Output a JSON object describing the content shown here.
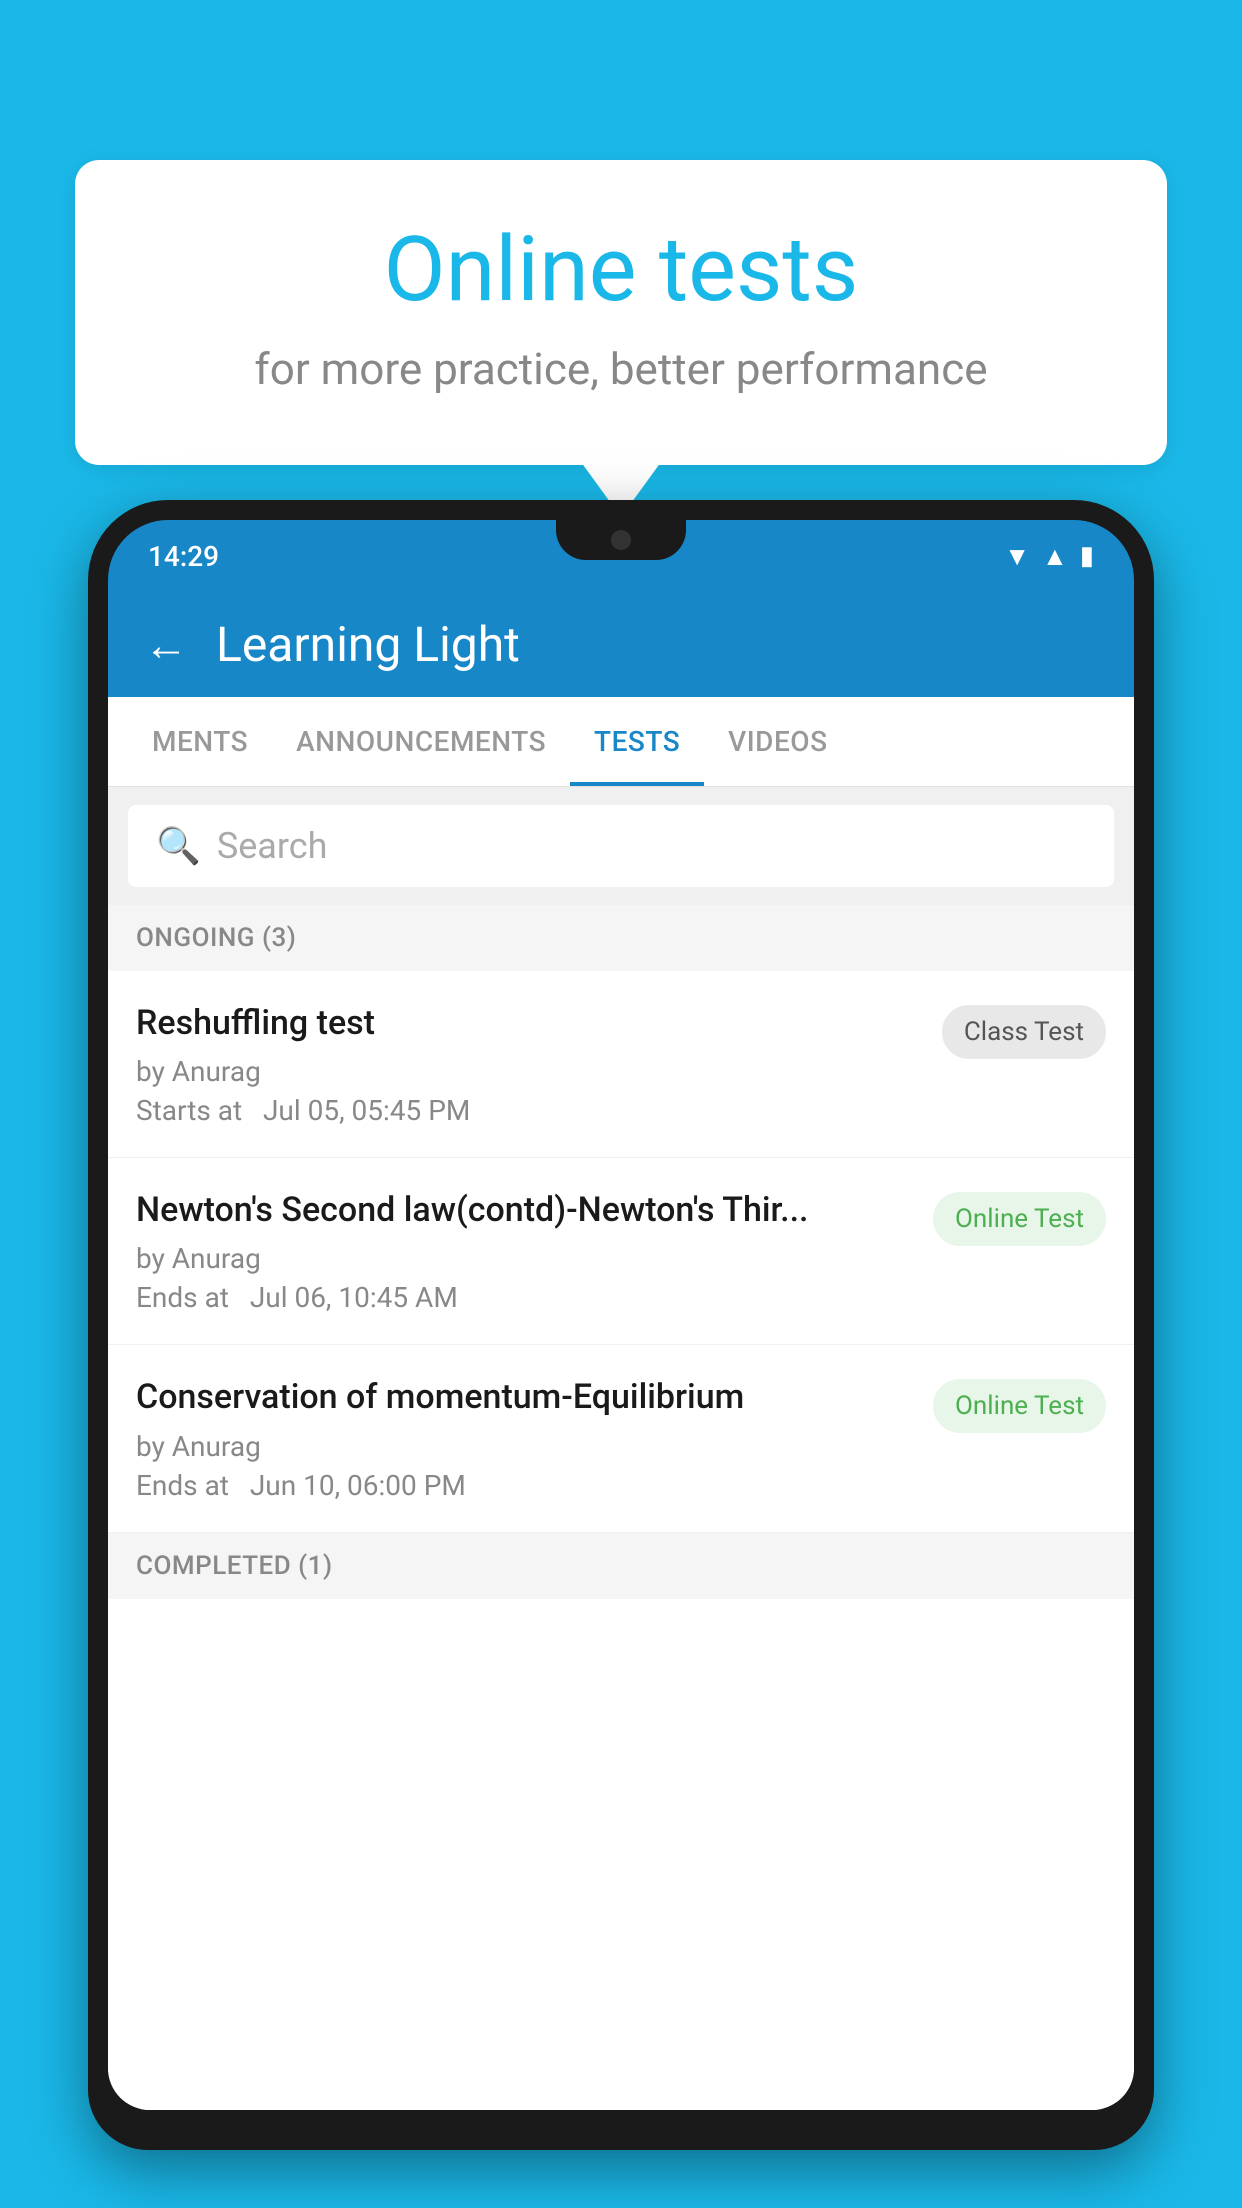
{
  "background": {
    "color": "#1ab8e8"
  },
  "speech_bubble": {
    "title": "Online tests",
    "subtitle": "for more practice, better performance"
  },
  "phone": {
    "status_bar": {
      "time": "14:29",
      "wifi": "▼",
      "signal": "▲",
      "battery": "▐"
    },
    "header": {
      "back_label": "←",
      "title": "Learning Light"
    },
    "tabs": [
      {
        "label": "MENTS",
        "active": false
      },
      {
        "label": "ANNOUNCEMENTS",
        "active": false
      },
      {
        "label": "TESTS",
        "active": true
      },
      {
        "label": "VIDEOS",
        "active": false
      }
    ],
    "search": {
      "placeholder": "Search"
    },
    "ongoing_section": {
      "label": "ONGOING (3)"
    },
    "tests": [
      {
        "name": "Reshuffling test",
        "author": "by Anurag",
        "time_label": "Starts at",
        "time": "Jul 05, 05:45 PM",
        "badge": "Class Test",
        "badge_type": "class"
      },
      {
        "name": "Newton's Second law(contd)-Newton's Thir...",
        "author": "by Anurag",
        "time_label": "Ends at",
        "time": "Jul 06, 10:45 AM",
        "badge": "Online Test",
        "badge_type": "online"
      },
      {
        "name": "Conservation of momentum-Equilibrium",
        "author": "by Anurag",
        "time_label": "Ends at",
        "time": "Jun 10, 06:00 PM",
        "badge": "Online Test",
        "badge_type": "online"
      }
    ],
    "completed_section": {
      "label": "COMPLETED (1)"
    }
  }
}
